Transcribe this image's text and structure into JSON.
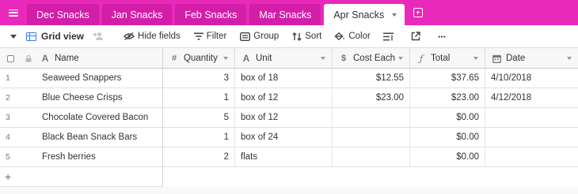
{
  "tabs": [
    {
      "label": "Dec Snacks",
      "active": false
    },
    {
      "label": "Jan Snacks",
      "active": false
    },
    {
      "label": "Feb Snacks",
      "active": false
    },
    {
      "label": "Mar Snacks",
      "active": false
    },
    {
      "label": "Apr Snacks",
      "active": true
    }
  ],
  "toolbar": {
    "view_name": "Grid view",
    "hide_fields": "Hide fields",
    "filter": "Filter",
    "group": "Group",
    "sort": "Sort",
    "color": "Color",
    "more": "···"
  },
  "columns": [
    {
      "label": "Name",
      "icon": "text-icon"
    },
    {
      "label": "Quantity",
      "icon": "hash-icon"
    },
    {
      "label": "Unit",
      "icon": "text-icon"
    },
    {
      "label": "Cost Each",
      "icon": "currency-icon"
    },
    {
      "label": "Total",
      "icon": "formula-icon"
    },
    {
      "label": "Date",
      "icon": "calendar-icon"
    }
  ],
  "rows": [
    {
      "num": "1",
      "name": "Seaweed Snappers",
      "quantity": "3",
      "unit": "box of 18",
      "cost_each": "$12.55",
      "total": "$37.65",
      "date": "4/10/2018"
    },
    {
      "num": "2",
      "name": "Blue Cheese Crisps",
      "quantity": "1",
      "unit": "box of 12",
      "cost_each": "$23.00",
      "total": "$23.00",
      "date": "4/12/2018"
    },
    {
      "num": "3",
      "name": "Chocolate Covered Bacon",
      "quantity": "5",
      "unit": "box of 12",
      "cost_each": "",
      "total": "$0.00",
      "date": ""
    },
    {
      "num": "4",
      "name": "Black Bean Snack Bars",
      "quantity": "1",
      "unit": "box of 24",
      "cost_each": "",
      "total": "$0.00",
      "date": ""
    },
    {
      "num": "5",
      "name": "Fresh berries",
      "quantity": "2",
      "unit": "flats",
      "cost_each": "",
      "total": "$0.00",
      "date": ""
    }
  ],
  "add_row_label": "+",
  "colors": {
    "tab_bar": "#e929ba",
    "accent": "#2d7ff9"
  }
}
